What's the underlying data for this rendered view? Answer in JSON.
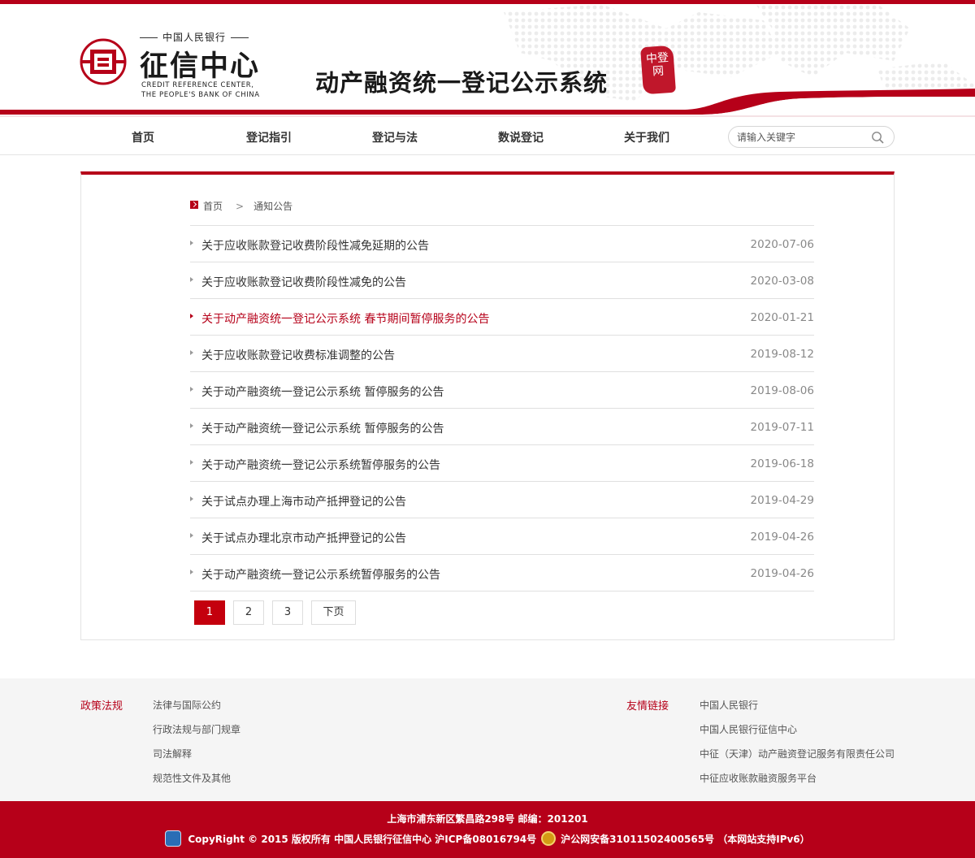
{
  "header": {
    "logo_top": "中国人民银行",
    "logo_cn": "征信中心",
    "logo_en_line1": "CREDIT REFERENCE CENTER,",
    "logo_en_line2": "THE PEOPLE'S BANK OF CHINA",
    "system_title": "动产融资统一登记公示系统",
    "seal_text": "中登网"
  },
  "nav": {
    "items": [
      "首页",
      "登记指引",
      "登记与法",
      "数说登记",
      "关于我们"
    ],
    "search_placeholder": "请输入关键字"
  },
  "breadcrumb": {
    "home": "首页",
    "current": "通知公告"
  },
  "notices": [
    {
      "title": "关于应收账款登记收费阶段性减免延期的公告",
      "date": "2020-07-06",
      "active": false
    },
    {
      "title": "关于应收账款登记收费阶段性减免的公告",
      "date": "2020-03-08",
      "active": false
    },
    {
      "title": "关于动产融资统一登记公示系统  春节期间暂停服务的公告",
      "date": "2020-01-21",
      "active": true
    },
    {
      "title": "关于应收账款登记收费标准调整的公告",
      "date": "2019-08-12",
      "active": false
    },
    {
      "title": "关于动产融资统一登记公示系统  暂停服务的公告",
      "date": "2019-08-06",
      "active": false
    },
    {
      "title": "关于动产融资统一登记公示系统  暂停服务的公告",
      "date": "2019-07-11",
      "active": false
    },
    {
      "title": "关于动产融资统一登记公示系统暂停服务的公告",
      "date": "2019-06-18",
      "active": false
    },
    {
      "title": "关于试点办理上海市动产抵押登记的公告",
      "date": "2019-04-29",
      "active": false
    },
    {
      "title": "关于试点办理北京市动产抵押登记的公告",
      "date": "2019-04-26",
      "active": false
    },
    {
      "title": "关于动产融资统一登记公示系统暂停服务的公告",
      "date": "2019-04-26",
      "active": false
    }
  ],
  "pagination": {
    "pages": [
      "1",
      "2",
      "3"
    ],
    "current": "1",
    "next": "下页"
  },
  "footer": {
    "policy_heading": "政策法规",
    "policy_links": [
      "法律与国际公约",
      "行政法规与部门规章",
      "司法解释",
      "规范性文件及其他"
    ],
    "friends_heading": "友情链接",
    "friend_links": [
      "中国人民银行",
      "中国人民银行征信中心",
      "中征（天津）动产融资登记服务有限责任公司",
      "中征应收账款融资服务平台"
    ],
    "address": "上海市浦东新区繁昌路298号 邮编：201201",
    "copyright": "CopyRight © 2015 版权所有 中国人民银行征信中心 沪ICP备08016794号",
    "police_record": "沪公网安备31011502400565号 （本网站支持IPv6）"
  },
  "colors": {
    "brand_red": "#b60019",
    "pager_active": "#c4000d"
  }
}
